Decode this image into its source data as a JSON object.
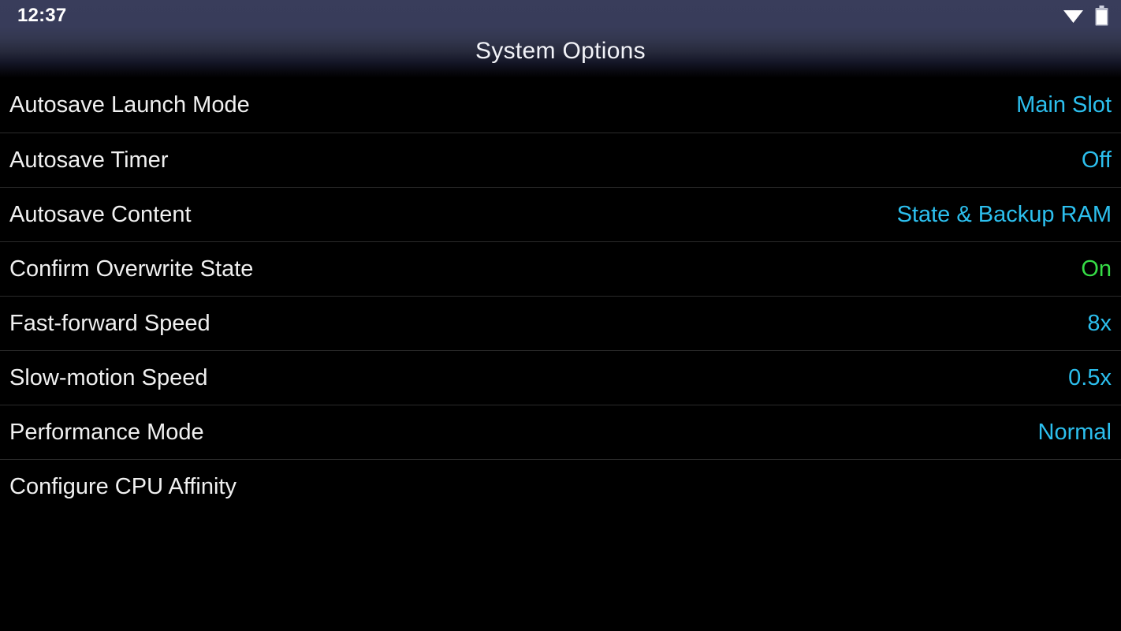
{
  "statusbar": {
    "clock": "12:37",
    "icons": [
      {
        "name": "wifi-icon",
        "state": "full"
      },
      {
        "name": "battery-icon",
        "state": "full"
      }
    ]
  },
  "header": {
    "title": "System Options"
  },
  "settings": {
    "rows": [
      {
        "label": "Autosave Launch Mode",
        "value": "Main Slot",
        "value_color": "cyan",
        "value_hex": "#2cbfee"
      },
      {
        "label": "Autosave Timer",
        "value": "Off",
        "value_color": "cyan",
        "value_hex": "#2cbfee"
      },
      {
        "label": "Autosave Content",
        "value": "State & Backup RAM",
        "value_color": "cyan",
        "value_hex": "#2cbfee"
      },
      {
        "label": "Confirm Overwrite State",
        "value": "On",
        "value_color": "green",
        "value_hex": "#36dd46"
      },
      {
        "label": "Fast-forward Speed",
        "value": "8x",
        "value_color": "cyan",
        "value_hex": "#2cbfee"
      },
      {
        "label": "Slow-motion Speed",
        "value": "0.5x",
        "value_color": "cyan",
        "value_hex": "#2cbfee"
      },
      {
        "label": "Performance Mode",
        "value": "Normal",
        "value_color": "cyan",
        "value_hex": "#2cbfee"
      },
      {
        "label": "Configure CPU Affinity",
        "value": "",
        "value_color": "cyan",
        "value_hex": "#2cbfee"
      }
    ]
  },
  "colors": {
    "background": "#000000",
    "header_top": "#393d5b",
    "header_bottom": "#000000",
    "label_text": "#f0f0f0",
    "accent_cyan": "#2cbfee",
    "accent_green": "#36dd46",
    "divider": "#2b2b2b"
  }
}
